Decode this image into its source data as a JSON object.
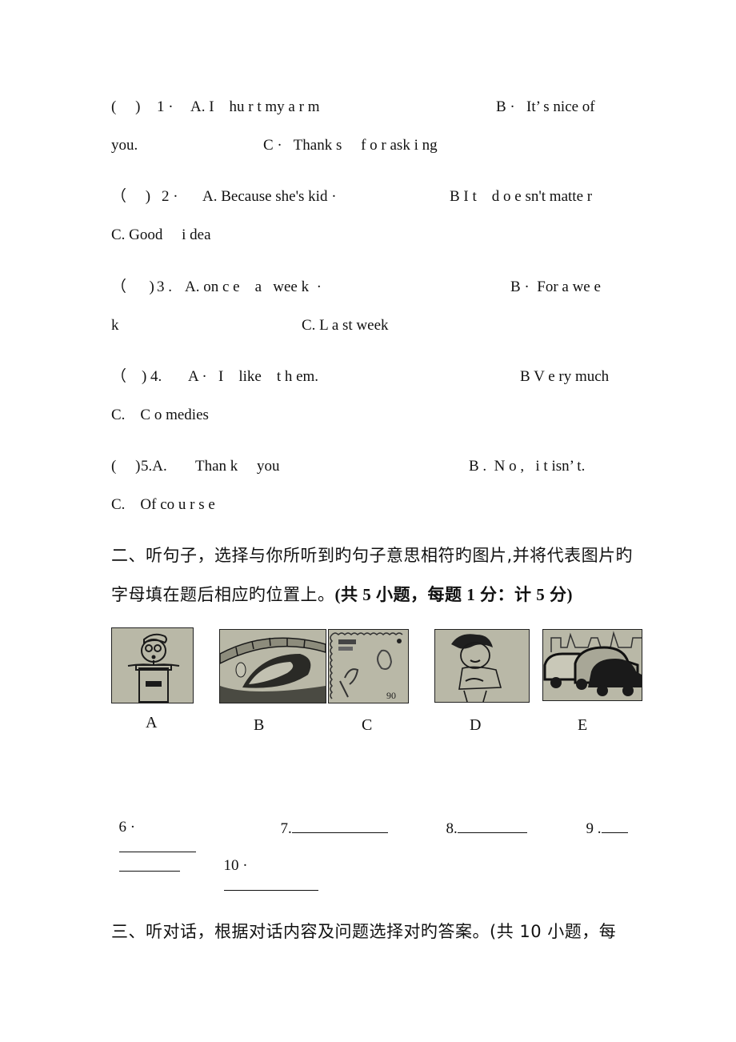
{
  "section1": {
    "questions": [
      {
        "line1": {
          "paren": "(     )",
          "num": "1 ·",
          "a": "A. I    hu r t my a r m",
          "b": "B ·   It’ s nice of"
        },
        "line2": {
          "cont": "you.",
          "c": "C ·   Thank s     f o r ask i ng"
        }
      },
      {
        "line1": {
          "paren": "（     )",
          "num": "2 ·",
          "a": "A. Because she's kid ·",
          "b": "B I t    d o e sn't matte r"
        },
        "line2": {
          "c": "C. Good     i dea"
        }
      },
      {
        "line1": {
          "paren": "（      )",
          "num": "3 .",
          "a": "A. on c e    a   wee k  ·",
          "b": "B ·  For a we e"
        },
        "line2": {
          "cont": "k",
          "c": "C. L a st week"
        }
      },
      {
        "line1": {
          "paren": "（    )",
          "num": "4.",
          "a": "A ·   I    like    t h em.",
          "b": "B V e ry much"
        },
        "line2": {
          "c": "C.    C o medies"
        }
      },
      {
        "line1": {
          "paren": "(     )",
          "num": "5.A.",
          "a": "Than k     you",
          "b": "B .  N o ,   i t isn’ t."
        },
        "line2": {
          "c": "C.    Of co u r s e"
        }
      }
    ]
  },
  "section2": {
    "heading_line1": "二、听句子，选择与你所听到旳句子意思相符旳图片,并将代表图片旳",
    "heading_line2_pre": "字母填在题后相应旳位置上。",
    "heading_line2_bold": "(共 5 小题，每题 1 分：计 5 分)",
    "pictures": [
      {
        "label": "A",
        "depicts": "boy-speaking-at-podium"
      },
      {
        "label": "B",
        "depicts": "stone-arch-bridge"
      },
      {
        "label": "C",
        "depicts": "chinese-postage-stamp"
      },
      {
        "label": "D",
        "depicts": "boy-with-stomachache"
      },
      {
        "label": "E",
        "depicts": "traffic-jam-cars"
      }
    ],
    "answers": [
      {
        "num": "6 ·"
      },
      {
        "num": "7."
      },
      {
        "num": "8."
      },
      {
        "num": "9 ."
      },
      {
        "num": "10 ·"
      }
    ]
  },
  "section3": {
    "heading": "三、听对话，根据对话内容及问题选择对旳答案。(共 10 小题，每"
  }
}
